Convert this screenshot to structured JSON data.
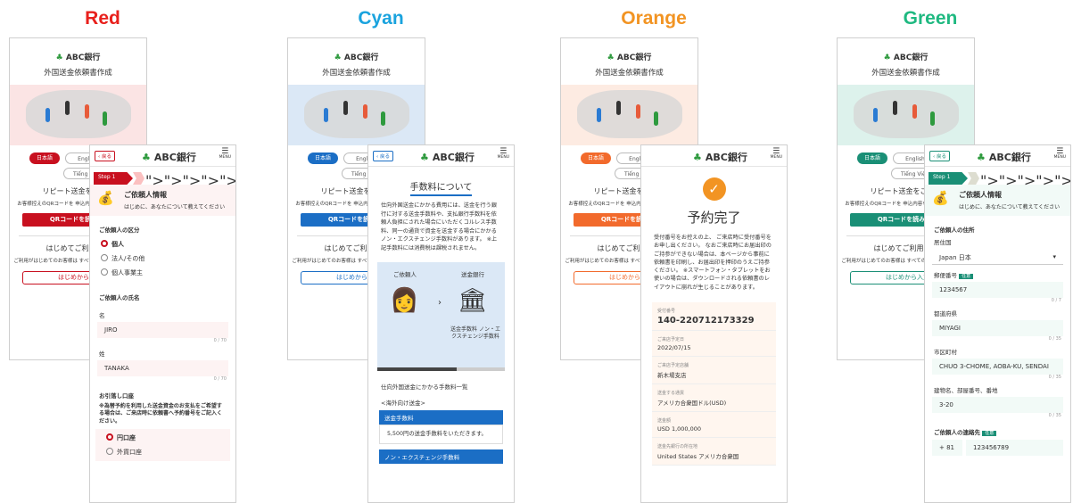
{
  "themes": [
    {
      "name": "Red",
      "color": "#e8201c",
      "accent": "#c8101f",
      "light": "#fbe4e4",
      "bg": "#fdf3f3"
    },
    {
      "name": "Cyan",
      "color": "#1aa3de",
      "accent": "#1b6ec5",
      "light": "#dbe8f6",
      "bg": "#f1f6fc"
    },
    {
      "name": "Orange",
      "color": "#f29423",
      "accent": "#f26a2c",
      "light": "#fdebe2",
      "bg": "#fff6ef"
    },
    {
      "name": "Green",
      "color": "#1fb981",
      "accent": "#1a8f76",
      "light": "#ddf2ec",
      "bg": "#f2faf7"
    }
  ],
  "common": {
    "bank": "ABC銀行",
    "subtitle": "外国送金依頼書作成",
    "lang_ja": "日本語",
    "lang_en": "English",
    "lang_vi": "Tiếng Việt",
    "repeat": "リピート送金をご希望",
    "repeat_note": "お客様控えのQRコードを 申込内容を自動入力できます",
    "qr_button": "QRコードを読み取る",
    "first": "はじめてご利用の方",
    "first_note": "ご利用がはじめてのお客様は すべての項目を新規でご入力",
    "start_button": "はじめから入力",
    "back": "戻る",
    "menu": "MENU"
  },
  "red": {
    "step": "Step 1",
    "req_title": "ご依頼人情報",
    "req_note": "はじめに、あなたについて教えてください",
    "kubun": "ご依頼人の区分",
    "opt1": "個人",
    "opt2": "法人/その他",
    "opt3": "個人事業主",
    "name_title": "ご依頼人の氏名",
    "mei": "名",
    "mei_val": "JIRO",
    "count1": "0 / 70",
    "sei": "姓",
    "sei_val": "TANAKA",
    "count2": "0 / 70",
    "acct": "お引落し口座",
    "acct_note": "※為替予約を利用した送金資金のお支払をご希望する場合は、ご来店時に依頼書へ予約番号をご記入ください。",
    "acct1": "円口座",
    "acct2": "外貨口座"
  },
  "cyan": {
    "title": "手数料について",
    "body": "仕向外国送金にかかる費用には、送金を行う銀行に対する送金手数料や、支払銀行手数料を依頼人負担にされた場合にいただくコルレス手数料、同一の通貨で資金を送金する場合にかかるノン・エクスチェンジ手数料があります。 ※上記手数料には消費税は課税されません。",
    "client": "ご依頼人",
    "bank": "送金銀行",
    "fees": "送金手数料 ノン・エクスチェンジ手数料",
    "list": "仕向外国送金にかかる手数料一覧",
    "region": "<海外向け送金>",
    "fee1": "送金手数料",
    "fee1_text": "5,500円の送金手数料をいただきます。",
    "fee2": "ノン・エクスチェンジ手数料"
  },
  "orange": {
    "title": "予約完了",
    "body": "受付番号をお控えの上、 ご来店時に受付番号をお申し出ください。 なおご来店時にお届出印のご持参ができない場合は、本ページから事前に依頼書を印刷し、お届出印を押印のうえご持参ください。 ※スマートフォン・タブレットをお使いの場合は、ダウンロードされる依頼書のレイアウトに崩れが生じることがあります。",
    "f1_label": "受付番号",
    "f1_val": "140-220712173329",
    "f2_label": "ご来店予定日",
    "f2_val": "2022/07/15",
    "f3_label": "ご来店予定店舗",
    "f3_val": "新木場支店",
    "f4_label": "送金する通貨",
    "f4_val": "アメリカ合衆国ドル(USD)",
    "f5_label": "送金額",
    "f5_val": "USD 1,000,000",
    "f6_label": "送金先銀行の所在地",
    "f6_val": "United States アメリカ合衆国"
  },
  "green": {
    "step": "Step 1",
    "req_title": "ご依頼人情報",
    "req_note": "はじめに、あなたについて教えてください",
    "addr": "ご依頼人の住所",
    "country_l": "居住国",
    "country": "Japan 日本",
    "zip_l": "郵便番号",
    "required": "任意",
    "zip": "1234567",
    "c1": "0 / 7",
    "pref_l": "都道府県",
    "pref": "MIYAGI",
    "c2": "0 / 35",
    "city_l": "市区町村",
    "city": "CHUO 3-CHOME, AOBA-KU, SENDAI",
    "c3": "0 / 35",
    "bld_l": "建物名、部屋番号、番地",
    "bld": "3-20",
    "c4": "0 / 35",
    "contact": "ご依頼人の連絡先",
    "cc": "+ 81",
    "tel": "123456789"
  }
}
